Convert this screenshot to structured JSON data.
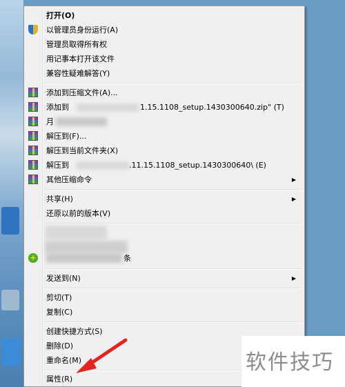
{
  "menu": {
    "items": [
      {
        "label": "打开(O)",
        "bold": true,
        "icon": null,
        "submenu": false
      },
      {
        "label": "以管理员身份运行(A)",
        "icon": "shield-icon",
        "submenu": false
      },
      {
        "label": "管理员取得所有权",
        "icon": null,
        "submenu": false
      },
      {
        "label": "用记事本打开该文件",
        "icon": null,
        "submenu": false
      },
      {
        "label": "兼容性疑难解答(Y)",
        "icon": null,
        "submenu": false
      },
      {
        "label": "添加到压缩文件(A)...",
        "icon": "winrar-icon",
        "submenu": false
      },
      {
        "label": "添加到",
        "tail": "1.15.1108_setup.1430300640.zip\" (T)",
        "icon": "winrar-icon",
        "submenu": false
      },
      {
        "label": "月",
        "icon": "winrar-icon",
        "submenu": false
      },
      {
        "label": "解压到(F)...",
        "icon": "winrar-icon",
        "submenu": false
      },
      {
        "label": "解压到当前文件夹(X)",
        "icon": "winrar-icon",
        "submenu": false
      },
      {
        "label": "解压到",
        "tail": ".11.15.1108_setup.1430300640\\ (E)",
        "icon": "winrar-icon",
        "submenu": false
      },
      {
        "label": "其他压缩命令",
        "icon": "winrar-icon",
        "submenu": true
      },
      {
        "label": "共享(H)",
        "icon": null,
        "submenu": true
      },
      {
        "label": "还原以前的版本(V)",
        "icon": null,
        "submenu": false
      },
      {
        "label": "条",
        "icon": "plus-icon",
        "submenu": false
      },
      {
        "label": "发送到(N)",
        "icon": null,
        "submenu": true
      },
      {
        "label": "剪切(T)",
        "icon": null,
        "submenu": false
      },
      {
        "label": "复制(C)",
        "icon": null,
        "submenu": false
      },
      {
        "label": "创建快捷方式(S)",
        "icon": null,
        "submenu": false
      },
      {
        "label": "删除(D)",
        "icon": null,
        "submenu": false
      },
      {
        "label": "重命名(M)",
        "icon": null,
        "submenu": false
      },
      {
        "label": "属性(R)",
        "icon": null,
        "submenu": false
      }
    ]
  },
  "watermark": "软件技巧",
  "colors": {
    "menu_bg": "#f0f0f0",
    "arrow_red": "#e52420",
    "desktop": "#6a9cc4"
  }
}
